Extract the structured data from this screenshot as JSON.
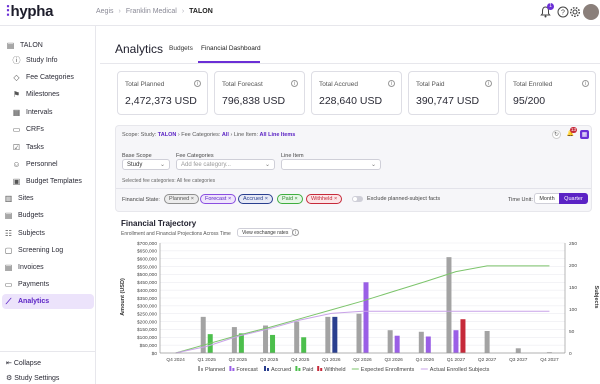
{
  "brand": {
    "name": "hypha"
  },
  "breadcrumb": {
    "items": [
      "Aegis",
      "Franklin Medical",
      "TALON"
    ]
  },
  "topbar": {
    "notification_count": "1"
  },
  "sidebar": {
    "study": "TALON",
    "items": [
      {
        "label": "Study Info",
        "icon": "info-icon"
      },
      {
        "label": "Fee Categories",
        "icon": "tag-icon"
      },
      {
        "label": "Milestones",
        "icon": "flag-icon"
      },
      {
        "label": "Intervals",
        "icon": "calendar-icon"
      },
      {
        "label": "CRFs",
        "icon": "form-icon"
      },
      {
        "label": "Tasks",
        "icon": "tasks-icon"
      },
      {
        "label": "Personnel",
        "icon": "person-icon"
      },
      {
        "label": "Budget Templates",
        "icon": "template-icon"
      }
    ],
    "top_items": [
      {
        "label": "Sites",
        "icon": "building-icon"
      },
      {
        "label": "Budgets",
        "icon": "wallet-icon"
      },
      {
        "label": "Subjects",
        "icon": "users-icon"
      },
      {
        "label": "Screening Log",
        "icon": "clipboard-icon"
      },
      {
        "label": "Invoices",
        "icon": "invoice-icon"
      },
      {
        "label": "Payments",
        "icon": "card-icon"
      },
      {
        "label": "Analytics",
        "icon": "chart-icon",
        "active": true
      }
    ],
    "collapse_label": "Collapse",
    "settings_label": "Study Settings"
  },
  "page": {
    "title": "Analytics",
    "tabs": [
      {
        "label": "Budgets"
      },
      {
        "label": "Financial Dashboard",
        "active": true
      }
    ]
  },
  "cards": [
    {
      "label": "Total Planned",
      "value": "2,472,373 USD"
    },
    {
      "label": "Total Forecast",
      "value": "796,838 USD"
    },
    {
      "label": "Total Accrued",
      "value": "228,640 USD"
    },
    {
      "label": "Total Paid",
      "value": "390,747 USD"
    },
    {
      "label": "Total Enrolled",
      "value": "95/200"
    }
  ],
  "filters": {
    "scope_prefix": "Scope:",
    "scope_study_label": "Study:",
    "scope_study": "TALON",
    "scope_fee_label": "Fee Categories:",
    "scope_fee": "All",
    "scope_line_label": "Line Item:",
    "scope_line": "All Line Items",
    "panel_badge": "13",
    "base_scope_label": "Base Scope",
    "base_scope_value": "Study",
    "fee_categories_label": "Fee Categories",
    "fee_categories_placeholder": "Add fee category...",
    "line_item_label": "Line Item",
    "selected_note": "Selected fee categories:",
    "selected_value": "All fee categories",
    "financial_state_label": "Financial State:",
    "states": [
      {
        "label": "Planned",
        "color": "#8f8f8f",
        "bg": "#ececec"
      },
      {
        "label": "Forecast",
        "color": "#8a4fe0",
        "bg": "#efe5fc"
      },
      {
        "label": "Accrued",
        "color": "#2a3f8f",
        "bg": "#e6e9f5"
      },
      {
        "label": "Paid",
        "color": "#3fae3f",
        "bg": "#e6f6e6"
      },
      {
        "label": "Withheld",
        "color": "#c62a3a",
        "bg": "#fbe5e7"
      }
    ],
    "exclude_label": "Exclude planned-subject facts",
    "time_unit_label": "Time Unit:",
    "time_units": [
      {
        "label": "Month",
        "active": false
      },
      {
        "label": "Quarter",
        "active": true
      }
    ]
  },
  "trajectory": {
    "title": "Financial Trajectory",
    "subtitle": "Enrollment and Financial Projections Across Time",
    "exchange_button": "View exchange rates"
  },
  "chart_data": {
    "type": "bar",
    "categories": [
      "Q4 2024",
      "Q1 2025",
      "Q2 2025",
      "Q3 2025",
      "Q4 2025",
      "Q1 2026",
      "Q2 2026",
      "Q3 2026",
      "Q4 2026",
      "Q1 2027",
      "Q2 2027",
      "Q3 2027",
      "Q4 2027"
    ],
    "ylabel": "Amount (USD)",
    "y2label": "Subjects",
    "ylim": [
      0,
      700000
    ],
    "y2lim": [
      0,
      250
    ],
    "yticks": [
      "$0",
      "$50,000",
      "$100,000",
      "$150,000",
      "$200,000",
      "$250,000",
      "$300,000",
      "$350,000",
      "$400,000",
      "$450,000",
      "$500,000",
      "$550,000",
      "$600,000",
      "$650,000",
      "$700,000"
    ],
    "y2ticks": [
      "0",
      "50",
      "100",
      "150",
      "200",
      "250"
    ],
    "series": [
      {
        "name": "Planned",
        "kind": "bar",
        "color": "#a3a3a3",
        "values": [
          0,
          230000,
          165000,
          175000,
          200000,
          230000,
          250000,
          145000,
          135000,
          610000,
          140000,
          30000,
          5000
        ]
      },
      {
        "name": "Forecast",
        "kind": "bar",
        "color": "#9a5fe6",
        "values": [
          0,
          0,
          0,
          0,
          0,
          0,
          450000,
          110000,
          105000,
          145000,
          0,
          0,
          0
        ]
      },
      {
        "name": "Accrued",
        "kind": "bar",
        "color": "#2a3f8f",
        "values": [
          0,
          0,
          0,
          0,
          0,
          230000,
          0,
          0,
          0,
          0,
          0,
          0,
          0
        ]
      },
      {
        "name": "Paid",
        "kind": "bar",
        "color": "#4cbf4c",
        "values": [
          0,
          120000,
          125000,
          115000,
          100000,
          0,
          0,
          0,
          0,
          0,
          0,
          0,
          0
        ]
      },
      {
        "name": "Withheld",
        "kind": "bar",
        "color": "#c62a3a",
        "values": [
          0,
          0,
          0,
          0,
          0,
          0,
          0,
          0,
          0,
          215000,
          0,
          0,
          0
        ]
      },
      {
        "name": "Expected Enrollments",
        "kind": "line",
        "axis": "right",
        "color": "#7cc46b",
        "values": [
          0,
          20,
          40,
          58,
          78,
          98,
          118,
          140,
          162,
          185,
          198,
          198,
          198
        ]
      },
      {
        "name": "Actual Enrolled Subjects",
        "kind": "line",
        "axis": "right",
        "color": "#c9a3e8",
        "values": [
          0,
          15,
          38,
          55,
          75,
          90,
          95,
          95,
          95,
          95,
          95,
          95,
          95
        ]
      }
    ],
    "legend": [
      "Planned",
      "Forecast",
      "Accrued",
      "Paid",
      "Withheld",
      "Expected Enrollments",
      "Actual Enrolled Subjects"
    ]
  }
}
